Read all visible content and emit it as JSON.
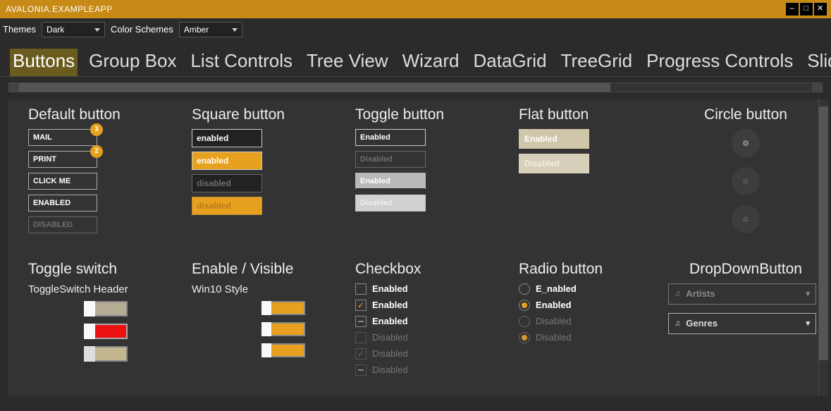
{
  "window": {
    "title": "AVALONIA.EXAMPLEAPP"
  },
  "options": {
    "themes_label": "Themes",
    "theme": "Dark",
    "schemes_label": "Color Schemes",
    "scheme": "Amber"
  },
  "tabs": [
    "Buttons",
    "Group Box",
    "List Controls",
    "Tree View",
    "Wizard",
    "DataGrid",
    "TreeGrid",
    "Progress Controls",
    "Sliders"
  ],
  "active_tab": "Buttons",
  "colors": {
    "accent": "#e8a11e"
  },
  "sections": {
    "default": {
      "title": "Default button",
      "buttons": [
        {
          "label": "MAIL",
          "badge": "3"
        },
        {
          "label": "PRINT",
          "badge": "2"
        },
        {
          "label": "CLICK ME"
        },
        {
          "label": "ENABLED"
        },
        {
          "label": "DISABLED",
          "disabled": true
        }
      ]
    },
    "square": {
      "title": "Square button",
      "items": [
        "enabled",
        "enabled",
        "disabled",
        "disabled"
      ]
    },
    "toggle": {
      "title": "Toggle button",
      "items": [
        "Enabled",
        "Disabled",
        "Enabled",
        "Disabled"
      ]
    },
    "flat": {
      "title": "Flat button",
      "items": [
        "Enabled",
        "Disabled"
      ]
    },
    "circle": {
      "title": "Circle button"
    },
    "tswitch": {
      "title": "Toggle switch",
      "header": "ToggleSwitch Header"
    },
    "evis": {
      "title": "Enable / Visible",
      "sub": "Win10 Style"
    },
    "checkbox": {
      "title": "Checkbox",
      "items": [
        {
          "label": "Enabled",
          "state": "off",
          "enabled": true,
          "bold": true
        },
        {
          "label": "Enabled",
          "state": "on",
          "enabled": true,
          "bold": true
        },
        {
          "label": "Enabled",
          "state": "ind",
          "enabled": true,
          "bold": true
        },
        {
          "label": "Disabled",
          "state": "off",
          "enabled": false
        },
        {
          "label": "Disabled",
          "state": "on",
          "enabled": false
        },
        {
          "label": "Disabled",
          "state": "ind",
          "enabled": false
        }
      ]
    },
    "radio": {
      "title": "Radio button",
      "items": [
        {
          "label": "E_nabled",
          "on": false,
          "enabled": true,
          "bold": true
        },
        {
          "label": "Enabled",
          "on": true,
          "enabled": true,
          "bold": true
        },
        {
          "label": "Disabled",
          "on": false,
          "enabled": false
        },
        {
          "label": "Disabled",
          "on": true,
          "enabled": false
        }
      ]
    },
    "dropdown": {
      "title": "DropDownButton",
      "items": [
        "Artists",
        "Genres"
      ]
    }
  }
}
